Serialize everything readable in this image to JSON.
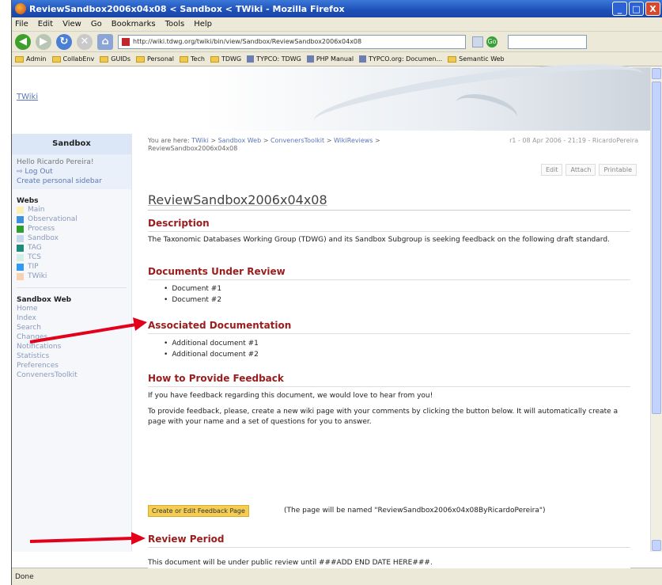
{
  "window": {
    "title": "ReviewSandbox2006x04x08 < Sandbox < TWiki - Mozilla Firefox",
    "min": "_",
    "max": "□",
    "close": "X"
  },
  "menubar": [
    "File",
    "Edit",
    "View",
    "Go",
    "Bookmarks",
    "Tools",
    "Help"
  ],
  "navbar": {
    "url": "http://wiki.tdwg.org/twiki/bin/view/Sandbox/ReviewSandbox2006x04x08",
    "go_label": "Go"
  },
  "bookmarks": [
    {
      "label": "Admin",
      "icon": "folder-icon"
    },
    {
      "label": "CollabEnv",
      "icon": "folder-icon"
    },
    {
      "label": "GUIDs",
      "icon": "folder-icon"
    },
    {
      "label": "Personal",
      "icon": "folder-icon"
    },
    {
      "label": "Tech",
      "icon": "folder-icon"
    },
    {
      "label": "TDWG",
      "icon": "folder-icon"
    },
    {
      "label": "TYPCO: TDWG",
      "icon": "page-icon"
    },
    {
      "label": "PHP Manual",
      "icon": "page-icon"
    },
    {
      "label": "TYPCO.org: Documen...",
      "icon": "page-icon"
    },
    {
      "label": "Semantic Web",
      "icon": "folder-icon"
    }
  ],
  "banner": {
    "logo": "TWiki"
  },
  "sidebar": {
    "web_title": "Sandbox",
    "hello": "Hello Ricardo Pereira!",
    "logout": "Log Out",
    "create_sidebar": "Create personal sidebar",
    "webs_heading": "Webs",
    "webs": [
      {
        "label": "Main",
        "color": "#fbf0b4"
      },
      {
        "label": "Observational",
        "color": "#3d8fdf"
      },
      {
        "label": "Process",
        "color": "#2ea02e"
      },
      {
        "label": "Sandbox",
        "color": "#c6d8ee"
      },
      {
        "label": "TAG",
        "color": "#1c8c7c"
      },
      {
        "label": "TCS",
        "color": "#d4eee4"
      },
      {
        "label": "TIP",
        "color": "#2f9bf5"
      },
      {
        "label": "TWiki",
        "color": "#f7d1b0"
      }
    ],
    "sandbox_web_heading": "Sandbox Web",
    "tools": [
      "Home",
      "Index",
      "Search",
      "Changes",
      "Notifications",
      "Statistics",
      "Preferences",
      "ConvenersToolkit"
    ]
  },
  "breadcrumb": {
    "prefix": "You are here:",
    "twiki": "TWiki",
    "sandbox_web": "Sandbox Web",
    "toolkit": "ConvenersToolkit",
    "reviews": "WikiReviews",
    "current": "ReviewSandbox2006x04x08",
    "sep": ">"
  },
  "revision": "r1 - 08 Apr 2006 - 21:19 - RicardoPereira",
  "actions": {
    "edit": "Edit",
    "attach": "Attach",
    "printable": "Printable"
  },
  "page": {
    "title": "ReviewSandbox2006x04x08",
    "description_heading": "Description",
    "description_text": "The Taxonomic Databases Working Group (TDWG) and its Sandbox Subgroup is seeking feedback on the following draft standard.",
    "docs_heading": "Documents Under Review",
    "docs": [
      "Document #1",
      "Document #2"
    ],
    "assoc_heading": "Associated Documentation",
    "assoc": [
      "Additional document #1",
      "Additional document #2"
    ],
    "feedback_heading": "How to Provide Feedback",
    "feedback_text1": "If you have feedback regarding this document, we would love to hear from you!",
    "feedback_text2": "To provide feedback, please, create a new wiki page with your comments by clicking the button below. It will automatically create a page with your name and a set of questions for you to answer.",
    "feedback_button": "Create or Edit Feedback Page",
    "feedback_note": "(The page will be named \"ReviewSandbox2006x04x08ByRicardoPereira\")",
    "period_heading": "Review Period",
    "period_text": "This document will be under public review until ###ADD END DATE HERE###."
  },
  "status": "Done",
  "colors": {
    "heading": "#9a1c1c",
    "link": "#5b77b8",
    "button": "#f4cd52",
    "arrow": "#e3001b"
  }
}
